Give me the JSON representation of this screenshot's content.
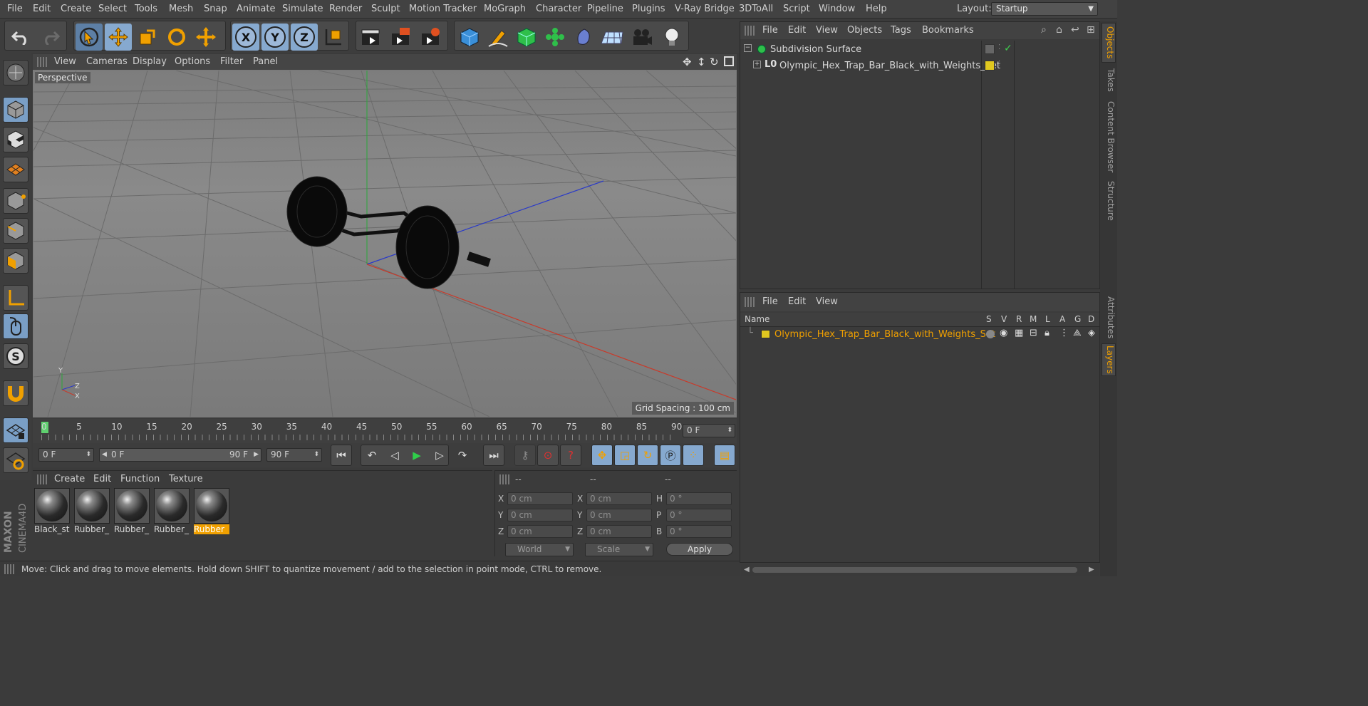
{
  "menubar": {
    "items": [
      "File",
      "Edit",
      "Create",
      "Select",
      "Tools",
      "Mesh",
      "Snap",
      "Animate",
      "Simulate",
      "Render",
      "Sculpt",
      "Motion Tracker",
      "MoGraph",
      "Character",
      "Pipeline",
      "Plugins",
      "V-Ray Bridge",
      "3DToAll",
      "Script",
      "Window",
      "Help"
    ],
    "layout_label": "Layout:",
    "layout_value": "Startup"
  },
  "toolbar": {
    "axis_x": "X",
    "axis_y": "Y",
    "axis_z": "Z"
  },
  "viewport": {
    "menu": [
      "View",
      "Cameras",
      "Display",
      "Options",
      "Filter",
      "Panel"
    ],
    "camera_label": "Perspective",
    "grid_spacing": "Grid Spacing : 100 cm",
    "axis_label_y": "Y",
    "axis_label_z": "Z",
    "axis_label_x": "X"
  },
  "timeline": {
    "ticks": [
      "0",
      "5",
      "10",
      "15",
      "20",
      "25",
      "30",
      "35",
      "40",
      "45",
      "50",
      "55",
      "60",
      "65",
      "70",
      "75",
      "80",
      "85",
      "90"
    ],
    "current_frame": "0 F"
  },
  "transport": {
    "start_field": "0 F",
    "range_start": "0 F",
    "range_end": "90 F",
    "end_field": "90 F"
  },
  "materials": {
    "menu": [
      "Create",
      "Edit",
      "Function",
      "Texture"
    ],
    "items": [
      {
        "label": "Black_st"
      },
      {
        "label": "Rubber_"
      },
      {
        "label": "Rubber_"
      },
      {
        "label": "Rubber_"
      },
      {
        "label": "Rubber"
      }
    ]
  },
  "coords": {
    "headers": [
      "--",
      "--",
      "--"
    ],
    "labels_col1": [
      "X",
      "Y",
      "Z"
    ],
    "labels_col2": [
      "X",
      "Y",
      "Z"
    ],
    "labels_col3": [
      "H",
      "P",
      "B"
    ],
    "values_col1": [
      "0 cm",
      "0 cm",
      "0 cm"
    ],
    "values_col2": [
      "0 cm",
      "0 cm",
      "0 cm"
    ],
    "values_col3": [
      "0 °",
      "0 °",
      "0 °"
    ],
    "mode_world": "World",
    "mode_scale": "Scale",
    "apply": "Apply"
  },
  "status": "Move: Click and drag to move elements. Hold down SHIFT to quantize movement / add to the selection in point mode, CTRL to remove.",
  "objects": {
    "menu": [
      "File",
      "Edit",
      "View",
      "Objects",
      "Tags",
      "Bookmarks"
    ],
    "rows": [
      {
        "name": "Subdivision Surface"
      },
      {
        "name": "Olympic_Hex_Trap_Bar_Black_with_Weights_Set"
      }
    ]
  },
  "layers": {
    "menu": [
      "File",
      "Edit",
      "View"
    ],
    "header_name": "Name",
    "header_cols": [
      "S",
      "V",
      "R",
      "M",
      "L",
      "A",
      "G",
      "D"
    ],
    "rows": [
      {
        "name": "Olympic_Hex_Trap_Bar_Black_with_Weights_Set",
        "color": "#e0c820"
      }
    ]
  },
  "sidetabs": [
    "Objects",
    "Takes",
    "Content Browser",
    "Structure",
    "Attributes",
    "Layers"
  ],
  "brand": {
    "maxon": "MAXON",
    "product": "CINEMA4D"
  },
  "colors": {
    "accent": "#f0a000",
    "selected_blue": "#7a9fc6",
    "layer_yellow": "#e0c820"
  }
}
